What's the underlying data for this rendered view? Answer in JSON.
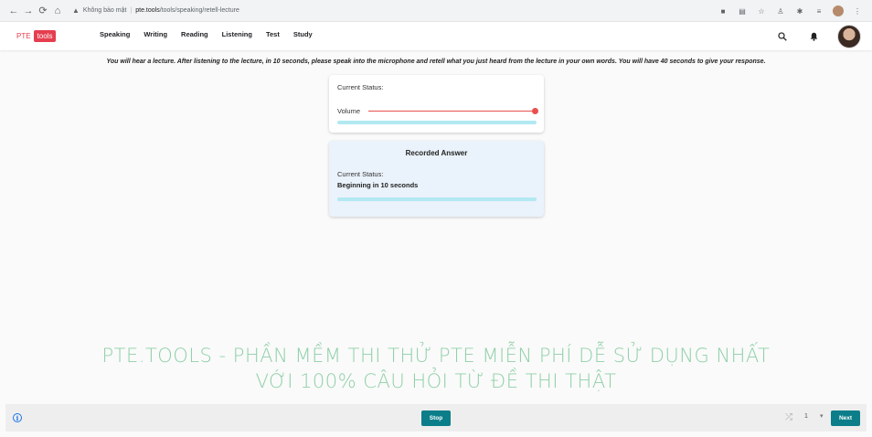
{
  "browser": {
    "security_icon": "warning-triangle-icon",
    "security_label": "Không bảo mật",
    "host": "pte.tools",
    "path": "/tools/speaking/retell-lecture"
  },
  "header": {
    "logo_left": "PTE",
    "logo_right": "tools",
    "nav": [
      "Speaking",
      "Writing",
      "Reading",
      "Listening",
      "Test",
      "Study"
    ]
  },
  "instruction": "You will hear a lecture. After listening to the lecture, in 10 seconds, please speak into the microphone and retell what you just heard from the lecture in your own words. You will have 40 seconds to give your response.",
  "recorder": {
    "status_label": "Current Status:",
    "volume_label": "Volume",
    "volume_level": 1.0,
    "progress": 1.0
  },
  "recorded_answer": {
    "title": "Recorded Answer",
    "status_label": "Current Status:",
    "status_value": "Beginning in 10 seconds",
    "progress": 1.0
  },
  "watermark": {
    "line1": "PTE.TOOLS - PHẦN MỀM THI THỬ PTE MIỄN PHÍ DỄ SỬ DỤNG NHẤT",
    "line2": "VỚI 100% CÂU HỎI TỪ ĐỀ THI THẬT"
  },
  "footer": {
    "stop_label": "Stop",
    "page_number": "1",
    "next_label": "Next"
  },
  "colors": {
    "brand_red": "#e53e4f",
    "button_teal": "#0b7e8a",
    "progress_cyan": "#b2e9f2",
    "volume_red": "#e84f4f",
    "watermark_green": "#8fd0a8"
  }
}
